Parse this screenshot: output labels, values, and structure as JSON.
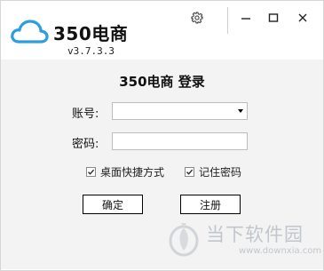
{
  "app": {
    "name": "350电商",
    "version": "v3.7.3.3"
  },
  "window_controls": {
    "settings_icon": "gear-icon",
    "minimize_icon": "minimize-icon",
    "maximize_icon": "maximize-icon",
    "close_icon": "close-icon"
  },
  "login": {
    "title": "350电商 登录",
    "account_label": "账号:",
    "account_value": "",
    "password_label": "密码:",
    "password_value": "",
    "desktop_shortcut_label": "桌面快捷方式",
    "desktop_shortcut_checked": true,
    "remember_password_label": "记住密码",
    "remember_password_checked": true,
    "ok_button": "确定",
    "register_button": "注册"
  },
  "watermark": {
    "text": "当下软件园",
    "url": "www.downxia.com"
  },
  "colors": {
    "brand_blue": "#2b9de0",
    "background_band": "#f3f3f3",
    "watermark": "#9aa3ad"
  }
}
